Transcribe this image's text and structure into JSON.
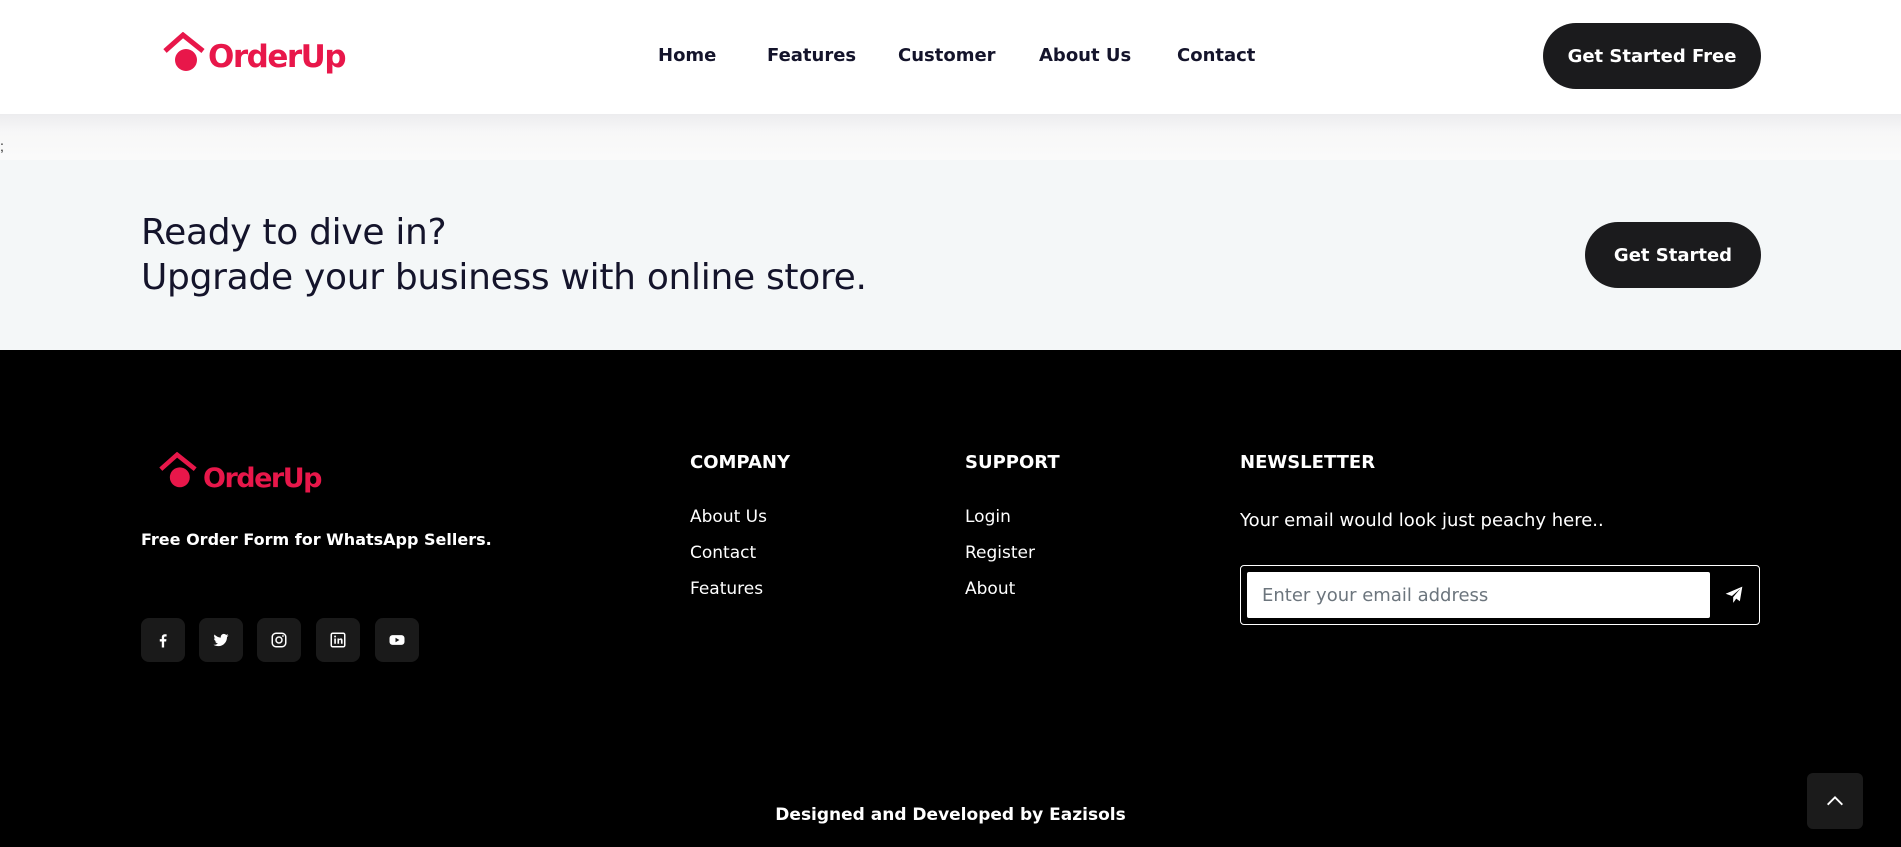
{
  "brand": {
    "name": "OrderUp",
    "color": "#e8174a"
  },
  "header": {
    "nav": [
      "Home",
      "Features",
      "Customer",
      "About Us",
      "Contact"
    ],
    "cta_label": "Get Started Free"
  },
  "stray_text": ";",
  "cta": {
    "line1": "Ready to dive in?",
    "line2": "Upgrade your business with online store.",
    "button_label": "Get Started"
  },
  "footer": {
    "tagline": "Free Order Form for WhatsApp Sellers.",
    "socials": [
      "facebook-icon",
      "twitter-icon",
      "instagram-icon",
      "linkedin-icon",
      "youtube-icon"
    ],
    "company": {
      "title": "COMPANY",
      "links": [
        "About Us",
        "Contact",
        "Features"
      ]
    },
    "support": {
      "title": "SUPPORT",
      "links": [
        "Login",
        "Register",
        "About"
      ]
    },
    "newsletter": {
      "title": "NEWSLETTER",
      "text": "Your email would look just peachy here..",
      "placeholder": "Enter your email address"
    },
    "credit": "Designed and Developed by Eazisols"
  }
}
